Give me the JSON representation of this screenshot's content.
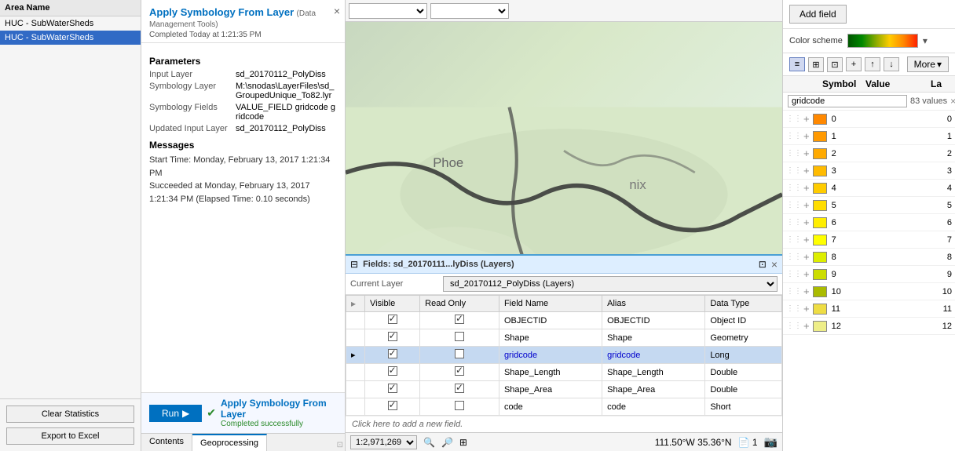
{
  "left_panel": {
    "area_name_header": "Area Name",
    "items": [
      {
        "label": "HUC - SubWaterSheds",
        "selected": false
      },
      {
        "label": "HUC - SubWaterSheds",
        "selected": true
      }
    ],
    "clear_stats_btn": "Clear Statistics",
    "export_excel_btn": "Export to Excel"
  },
  "tool_panel": {
    "title": "Apply Symbology From Layer",
    "subtitle": "(Data Management Tools)",
    "completed": "Completed Today at 1:21:35 PM",
    "params_label": "Parameters",
    "params": [
      {
        "label": "Input Layer",
        "value": "sd_20170112_PolyDiss"
      },
      {
        "label": "Symbology Layer",
        "value": "M:\\snodas\\LayerFiles\\sd_GroupedUnique_To82.lyr"
      },
      {
        "label": "Symbology Fields",
        "value": "VALUE_FIELD gridcode gridcode"
      },
      {
        "label": "Updated Input Layer",
        "value": "sd_20170112_PolyDiss"
      }
    ],
    "messages_label": "Messages",
    "messages": [
      "Start Time: Monday, February 13, 2017 1:21:34 PM",
      "Succeeded at Monday, February 13, 2017 1:21:34 PM (Elapsed Time: 0.10 seconds)"
    ],
    "run_btn": "Run",
    "gp_item_title": "Apply Symbology From Layer",
    "gp_item_sub": "Completed successfully",
    "tabs": [
      "Contents",
      "Geoprocessing"
    ]
  },
  "map": {
    "dropdown1_value": "",
    "dropdown2_value": "",
    "scale": "1:2,971,269",
    "coords": "111.50°W 35.36°N",
    "page": "1",
    "fields_panel": {
      "title": "Fields:  sd_20170111...lyDiss (Layers)",
      "current_layer_label": "Current Layer",
      "current_layer_value": "sd_20170112_PolyDiss (Layers)",
      "columns": [
        "Visible",
        "Read Only",
        "Field Name",
        "Alias",
        "Data Type"
      ],
      "rows": [
        {
          "visible": true,
          "readonly": true,
          "field_name": "OBJECTID",
          "alias": "OBJECTID",
          "data_type": "Object ID",
          "selected": false
        },
        {
          "visible": true,
          "readonly": false,
          "field_name": "Shape",
          "alias": "Shape",
          "data_type": "Geometry",
          "selected": false
        },
        {
          "visible": true,
          "readonly": false,
          "field_name": "gridcode",
          "alias": "gridcode",
          "data_type": "Long",
          "selected": true
        },
        {
          "visible": true,
          "readonly": true,
          "field_name": "Shape_Length",
          "alias": "Shape_Length",
          "data_type": "Double",
          "selected": false
        },
        {
          "visible": true,
          "readonly": true,
          "field_name": "Shape_Area",
          "alias": "Shape_Area",
          "data_type": "Double",
          "selected": false
        },
        {
          "visible": true,
          "readonly": false,
          "field_name": "code",
          "alias": "code",
          "data_type": "Short",
          "selected": false
        }
      ],
      "add_row": "Click here to add a new field."
    }
  },
  "right_panel": {
    "add_field_btn": "Add field",
    "color_scheme_label": "Color scheme",
    "sym_toolbar": {
      "btn1": "≡",
      "btn2": "⊞",
      "btn3": "⊡",
      "btn4": "+",
      "btn5": "↑",
      "btn6": "↓",
      "more_btn": "More",
      "chevron": "▾"
    },
    "columns": {
      "symbol": "Symbol",
      "value": "Value",
      "label": "La"
    },
    "filter": {
      "placeholder": "gridcode",
      "count": "83 values",
      "clear": "×"
    },
    "rows": [
      {
        "value": "0",
        "label": "0",
        "color": "#ff8800"
      },
      {
        "value": "1",
        "label": "1",
        "color": "#ff9900"
      },
      {
        "value": "2",
        "label": "2",
        "color": "#ffaa00"
      },
      {
        "value": "3",
        "label": "3",
        "color": "#ffbb00"
      },
      {
        "value": "4",
        "label": "4",
        "color": "#ffcc00"
      },
      {
        "value": "5",
        "label": "5",
        "color": "#ffdd00"
      },
      {
        "value": "6",
        "label": "6",
        "color": "#ffee00"
      },
      {
        "value": "7",
        "label": "7",
        "color": "#ffff00"
      },
      {
        "value": "8",
        "label": "8",
        "color": "#ddee00"
      },
      {
        "value": "9",
        "label": "9",
        "color": "#ccdd00"
      },
      {
        "value": "10",
        "label": "10",
        "color": "#aabb00"
      },
      {
        "value": "11",
        "label": "11",
        "color": "#eedd44"
      },
      {
        "value": "12",
        "label": "12",
        "color": "#eeee88"
      }
    ]
  }
}
